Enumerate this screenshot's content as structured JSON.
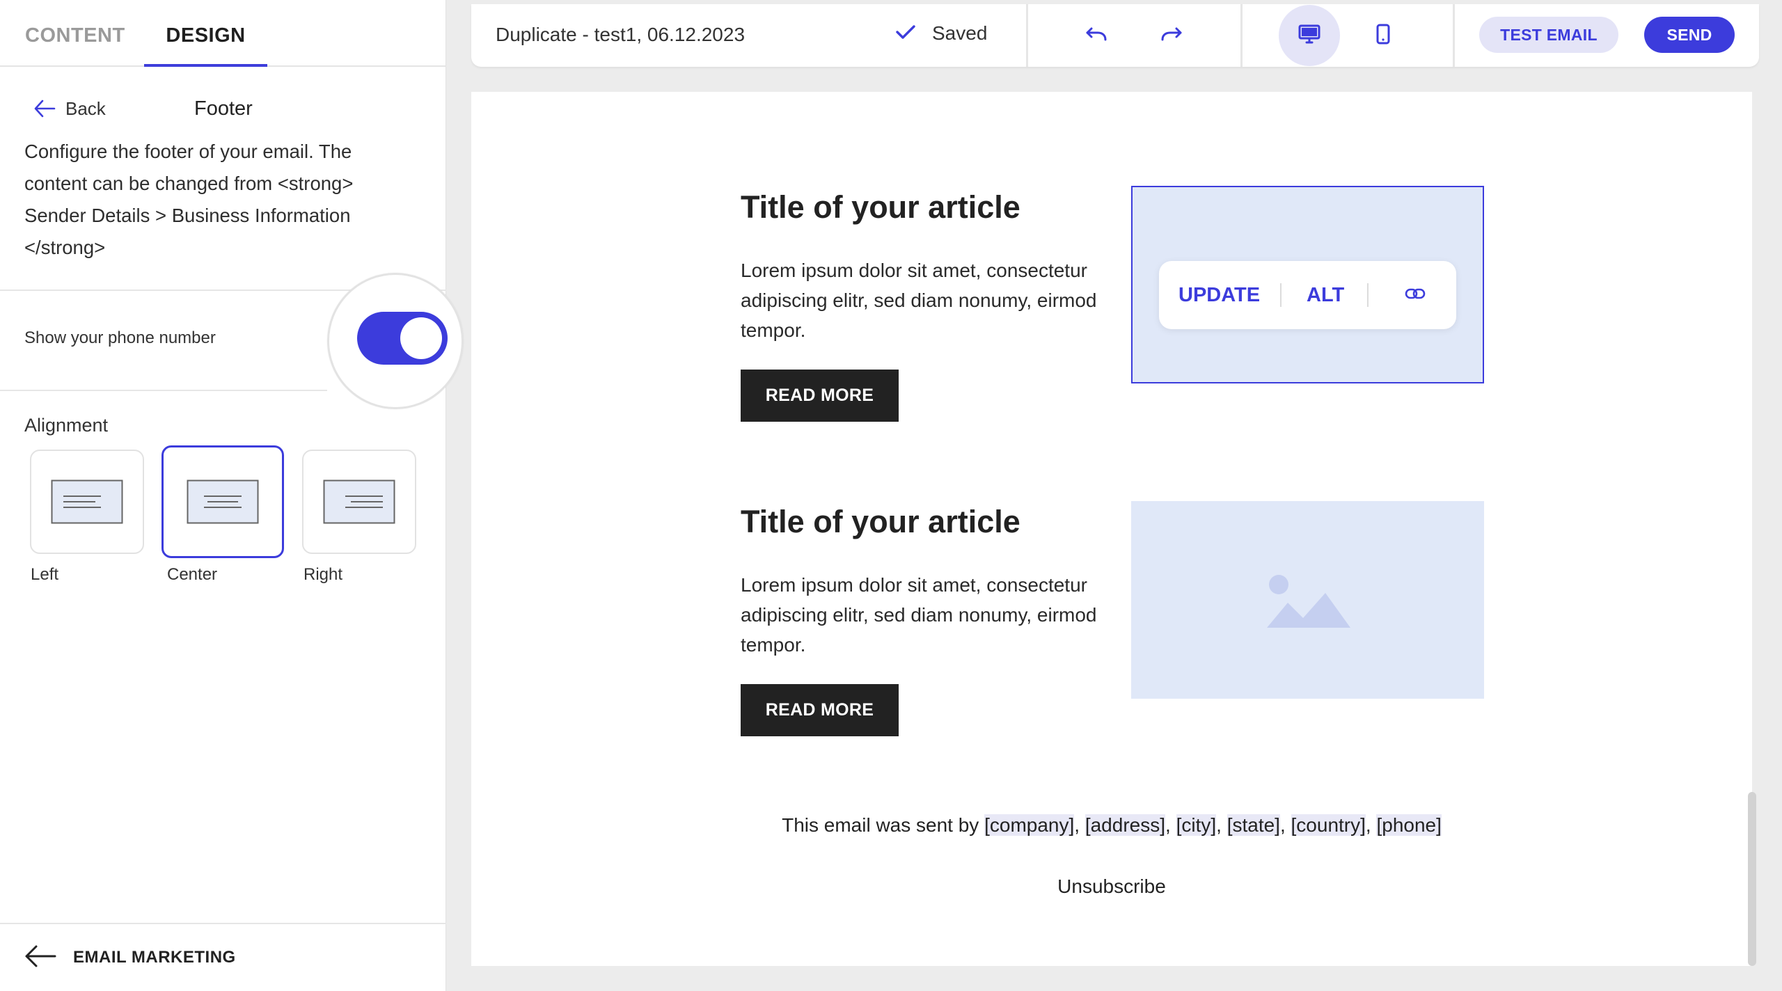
{
  "sidebar": {
    "tabs": [
      {
        "label": "CONTENT",
        "active": false
      },
      {
        "label": "DESIGN",
        "active": true
      }
    ],
    "back_label": "Back",
    "panel_title": "Footer",
    "description": "Configure the footer of your email. The content can be changed from <strong> Sender Details > Business Information </strong>",
    "phone_toggle": {
      "label": "Show your phone number",
      "on": true
    },
    "alignment": {
      "heading": "Alignment",
      "options": [
        {
          "label": "Left",
          "selected": false
        },
        {
          "label": "Center",
          "selected": true
        },
        {
          "label": "Right",
          "selected": false
        }
      ]
    },
    "footer_link": "EMAIL MARKETING"
  },
  "topbar": {
    "doc_title": "Duplicate - test1, 06.12.2023",
    "saved_status": "Saved",
    "test_email_label": "TEST EMAIL",
    "send_label": "SEND",
    "preview_mode": "desktop"
  },
  "email": {
    "articles": [
      {
        "title": "Title of your article",
        "body": "Lorem ipsum dolor sit amet, consectetur adipiscing elitr, sed diam nonumy, eirmod tempor.",
        "button": "READ MORE"
      },
      {
        "title": "Title of your article",
        "body": "Lorem ipsum dolor sit amet, consectetur adipiscing elitr, sed diam nonumy, eirmod tempor.",
        "button": "READ MORE"
      }
    ],
    "image_toolbar": {
      "update_label": "UPDATE",
      "alt_label": "ALT"
    },
    "footer": {
      "prefix": "This email was sent by ",
      "company": "[company]",
      "address": "[address]",
      "city": "[city]",
      "state": "[state]",
      "country": "[country]",
      "phone": "[phone]",
      "separator": ", ",
      "unsubscribe": "Unsubscribe"
    }
  },
  "colors": {
    "accent": "#3c3cdc",
    "accent_light": "#e4e4f7",
    "image_placeholder": "#e0e8f8",
    "button_dark": "#222222"
  }
}
